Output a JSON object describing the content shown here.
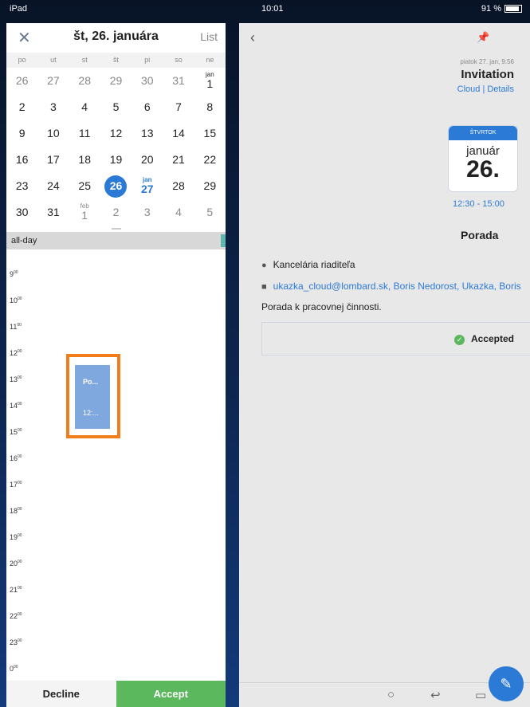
{
  "status": {
    "device": "iPad",
    "time": "10:01",
    "battery": "91 %"
  },
  "calendar": {
    "title": "št, 26. januára",
    "list_label": "List",
    "weekdays": [
      "po",
      "ut",
      "st",
      "št",
      "pi",
      "so",
      "ne"
    ],
    "weeks": [
      [
        "26",
        "27",
        "28",
        "29",
        "30",
        "31",
        "jan 1"
      ],
      [
        "2",
        "3",
        "4",
        "5",
        "6",
        "7",
        "8"
      ],
      [
        "9",
        "10",
        "11",
        "12",
        "13",
        "14",
        "15"
      ],
      [
        "16",
        "17",
        "18",
        "19",
        "20",
        "21",
        "22"
      ],
      [
        "23",
        "24",
        "25",
        "26",
        "jan 27",
        "28",
        "29"
      ],
      [
        "30",
        "31",
        "feb 1",
        "2",
        "3",
        "4",
        "5"
      ]
    ],
    "selected": "26",
    "allday_label": "all-day",
    "hours": [
      "9",
      "10",
      "11",
      "12",
      "13",
      "14",
      "15",
      "16",
      "17",
      "18",
      "19",
      "20",
      "21",
      "22",
      "23",
      "0"
    ],
    "event": {
      "title": "Po...",
      "time": "12:..."
    }
  },
  "actions": {
    "decline": "Decline",
    "accept": "Accept"
  },
  "detail": {
    "meta": "piatok 27. jan, 9:56",
    "subject": "Invitation",
    "links": "Cloud | Details",
    "card": {
      "dow": "ŠTVRTOK",
      "month": "január",
      "day": "26."
    },
    "time_range": "12:30 - 15:00",
    "title": "Porada",
    "location": "Kancelária riaditeľa",
    "attendees": "ukazka_cloud@lombard.sk, Boris Nedorost, Ukazka, Boris",
    "description": "Porada k pracovnej činnosti.",
    "status": "Accepted"
  }
}
